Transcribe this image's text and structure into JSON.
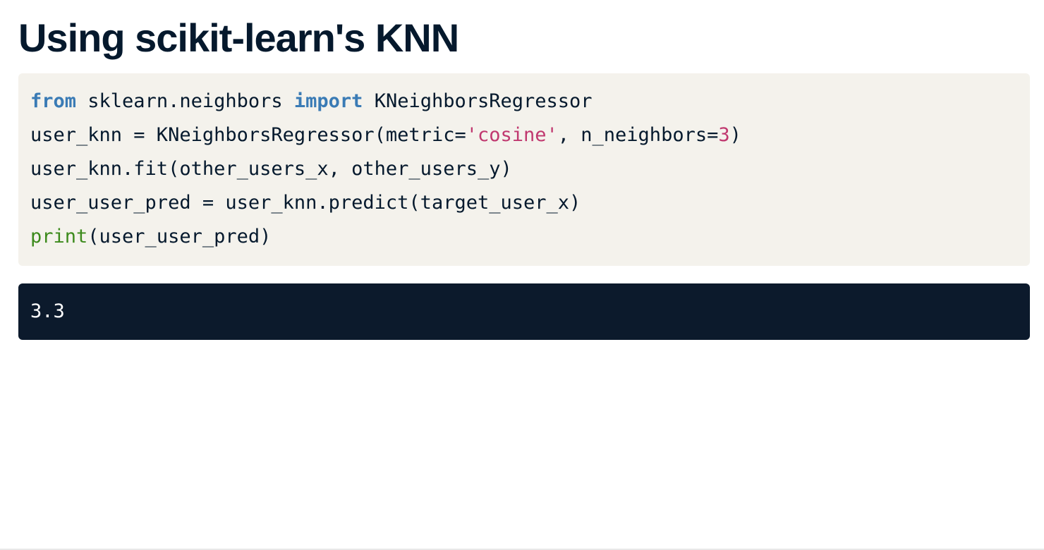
{
  "slide": {
    "title": "Using scikit-learn's KNN"
  },
  "code": {
    "language": "python",
    "lines": [
      {
        "tokens": [
          {
            "t": "kw",
            "v": "from"
          },
          {
            "t": "plain",
            "v": " sklearn.neighbors "
          },
          {
            "t": "kw",
            "v": "import"
          },
          {
            "t": "plain",
            "v": " KNeighborsRegressor"
          }
        ]
      },
      {
        "tokens": [
          {
            "t": "plain",
            "v": "user_knn = KNeighborsRegressor(metric="
          },
          {
            "t": "str",
            "v": "'cosine'"
          },
          {
            "t": "plain",
            "v": ", n_neighbors="
          },
          {
            "t": "num",
            "v": "3"
          },
          {
            "t": "plain",
            "v": ")"
          }
        ]
      },
      {
        "tokens": [
          {
            "t": "plain",
            "v": "user_knn.fit(other_users_x, other_users_y)"
          }
        ]
      },
      {
        "tokens": [
          {
            "t": "plain",
            "v": "user_user_pred = user_knn.predict(target_user_x)"
          }
        ]
      },
      {
        "tokens": [
          {
            "t": "fn",
            "v": "print"
          },
          {
            "t": "plain",
            "v": "(user_user_pred)"
          }
        ]
      }
    ]
  },
  "output": {
    "text": "3.3"
  },
  "colors": {
    "title": "#05192d",
    "code_background": "#f4f2ec",
    "keyword": "#3a7bb5",
    "string": "#c0386f",
    "number": "#c0386f",
    "builtin_function": "#3c8a1c",
    "output_background": "#0c1a2c",
    "output_text": "#ffffff"
  }
}
